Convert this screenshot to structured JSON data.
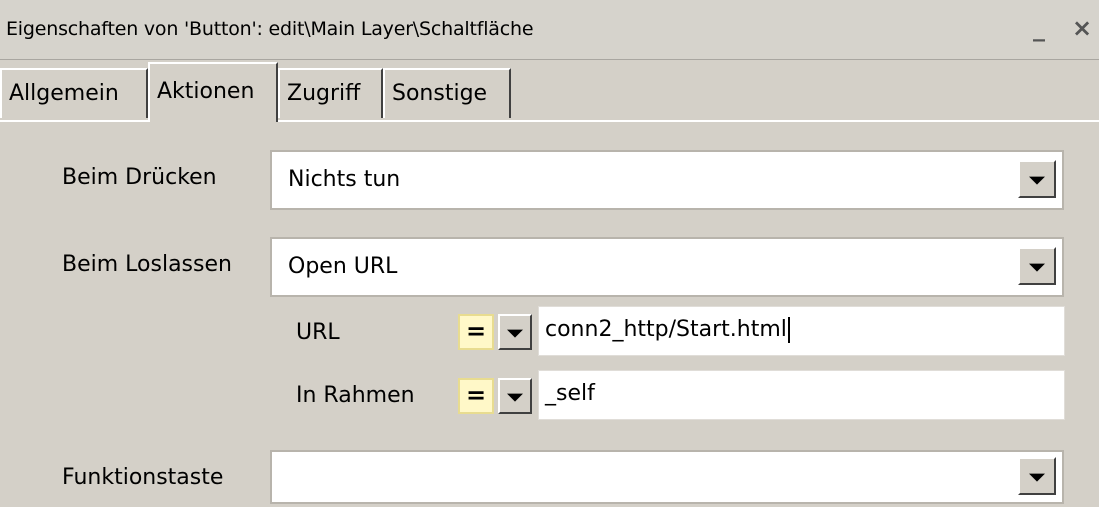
{
  "window": {
    "title": "Eigenschaften von 'Button': edit\\Main Layer\\Schaltfläche",
    "minimize_label": "_",
    "close_label": "×"
  },
  "tabs": [
    {
      "label": "Allgemein",
      "active": false
    },
    {
      "label": "Aktionen",
      "active": true
    },
    {
      "label": "Zugriff",
      "active": false
    },
    {
      "label": "Sonstige",
      "active": false
    }
  ],
  "actions": {
    "on_press": {
      "label": "Beim Drücken",
      "value": "Nichts tun"
    },
    "on_release": {
      "label": "Beim Loslassen",
      "value": "Open URL"
    },
    "url": {
      "label": "URL",
      "operator": "=",
      "value": "conn2_http/Start.html"
    },
    "frame": {
      "label": "In Rahmen",
      "operator": "=",
      "value": "_self"
    },
    "function_key": {
      "label": "Funktionstaste",
      "value": ""
    }
  },
  "icons": {
    "dropdown": "chevron-down-icon",
    "minimize": "minimize-icon",
    "close": "close-icon"
  }
}
